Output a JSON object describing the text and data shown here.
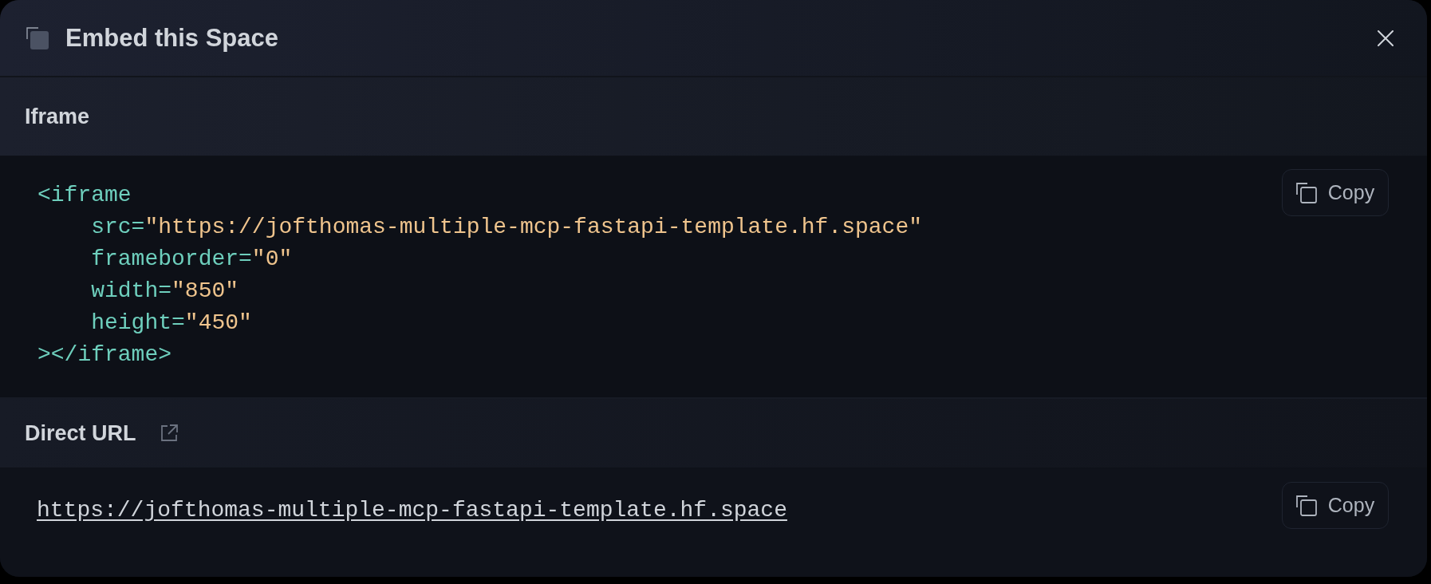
{
  "dialog": {
    "title": "Embed this Space"
  },
  "sections": [
    {
      "kind": "code",
      "heading": "Iframe",
      "code": {
        "open_tag": "<iframe",
        "attributes": [
          {
            "name": "src=",
            "value": "\"https://jofthomas-multiple-mcp-fastapi-template.hf.space\""
          },
          {
            "name": "frameborder=",
            "value": "\"0\""
          },
          {
            "name": "width=",
            "value": "\"850\""
          },
          {
            "name": "height=",
            "value": "\"450\""
          }
        ],
        "close_tag": "></iframe>"
      },
      "copy_button": "Copy"
    },
    {
      "kind": "url",
      "heading": "Direct URL",
      "url": "https://jofthomas-multiple-mcp-fastapi-template.hf.space",
      "copy_button": "Copy"
    }
  ]
}
